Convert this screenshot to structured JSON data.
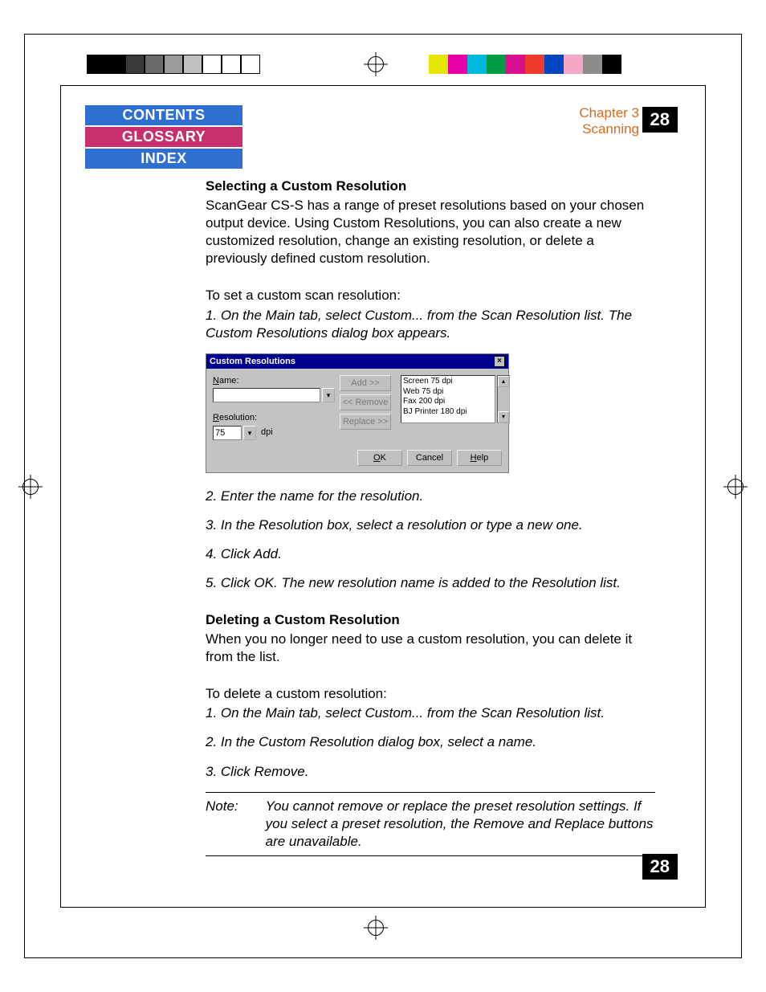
{
  "header": {
    "nav": {
      "contents": "CONTENTS",
      "glossary": "GLOSSARY",
      "index": "INDEX"
    },
    "chapter_line1": "Chapter 3",
    "chapter_line2": "Scanning",
    "page_number": "28"
  },
  "section1": {
    "heading": "Selecting a Custom Resolution",
    "intro": "ScanGear CS-S has a range of preset resolutions based on your chosen output device. Using Custom Resolutions, you can also create a new customized resolution, change an existing resolution, or delete a previously defined custom resolution.",
    "set_head": "To set a custom scan resolution:",
    "step1": "1. On the Main tab, select Custom... from the Scan Resolution list. The Custom Resolutions dialog box appears.",
    "step2": "2. Enter the name for the resolution.",
    "step3": "3. In the Resolution box, select a resolution or type a new one.",
    "step4": "4. Click Add.",
    "step5": "5. Click OK. The new resolution name is added to the Resolution list."
  },
  "dialog": {
    "title": "Custom Resolutions",
    "name_label": "Name:",
    "name_value": "",
    "res_label": "Resolution:",
    "res_value": "75",
    "res_unit": "dpi",
    "btn_add": "Add >>",
    "btn_remove": "<< Remove",
    "btn_replace": "Replace >>",
    "list_items": [
      "Screen 75 dpi",
      "Web 75 dpi",
      "Fax 200 dpi",
      "BJ Printer 180 dpi"
    ],
    "btn_ok": "OK",
    "btn_cancel": "Cancel",
    "btn_help": "Help"
  },
  "section2": {
    "heading": "Deleting a Custom Resolution",
    "intro": "When you no longer need to use a custom resolution, you can delete it from the list.",
    "del_head": "To delete a custom resolution:",
    "step1": "1. On the Main tab, select Custom... from the Scan Resolution list.",
    "step2": "2. In the Custom Resolution dialog box, select a name.",
    "step3": "3. Click Remove."
  },
  "note": {
    "label": "Note:",
    "text": "You cannot remove or replace the preset resolution settings. If you select a preset resolution, the Remove and Replace buttons are unavailable."
  },
  "colorbars": {
    "left": [
      "#000",
      "#000",
      "#3a3a3a",
      "#6a6a6a",
      "#9a9a9a",
      "#c0c0c0",
      "#fff",
      "#fff",
      "#fff"
    ],
    "right": [
      "#fff",
      "#e6e600",
      "#e600a6",
      "#00b7e0",
      "#009944",
      "#d80f8c",
      "#ef3b2e",
      "#0046be",
      "#f5a7c7",
      "#8c8c8c",
      "#000"
    ]
  }
}
